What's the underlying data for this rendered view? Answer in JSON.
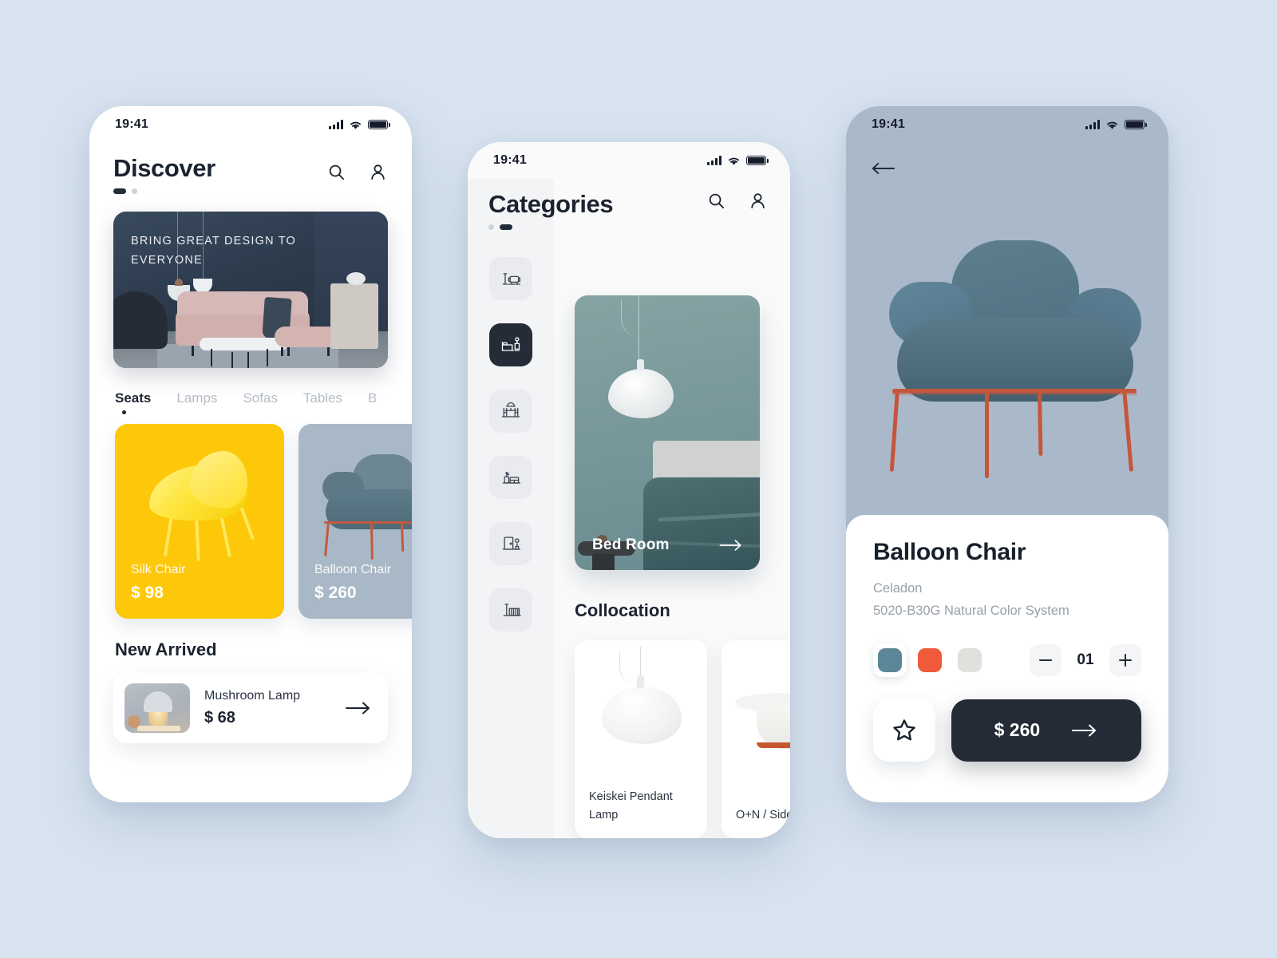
{
  "status_bar": {
    "time": "19:41",
    "signal_icon": "signal-bars-icon",
    "wifi_icon": "wifi-icon",
    "battery_icon": "battery-icon"
  },
  "discover": {
    "title": "Discover",
    "search_icon": "search-icon",
    "profile_icon": "profile-icon",
    "pagination": {
      "active_index": 0,
      "count": 2
    },
    "banner": {
      "headline": "BRING GREAT DESIGN TO EVERYONE",
      "wall_color": "#2e3d4f",
      "sofa_color": "#cfb0ad"
    },
    "tabs": [
      {
        "label": "Seats",
        "active": true
      },
      {
        "label": "Lamps",
        "active": false
      },
      {
        "label": "Sofas",
        "active": false
      },
      {
        "label": "Tables",
        "active": false
      },
      {
        "label": "B",
        "active": false
      }
    ],
    "products": [
      {
        "name": "Silk Chair",
        "price": "$ 98",
        "bg_color": "#fdc70a"
      },
      {
        "name": "Balloon Chair",
        "price": "$ 260",
        "bg_color": "#a9b8c6"
      }
    ],
    "new_arrived": {
      "section_title": "New Arrived",
      "item": {
        "name": "Mushroom Lamp",
        "price": "$ 68",
        "arrow_icon": "arrow-right-icon"
      }
    }
  },
  "categories": {
    "title": "Categories",
    "search_icon": "search-icon",
    "profile_icon": "profile-icon",
    "pagination": {
      "active_index": 1,
      "count": 2
    },
    "rail": [
      {
        "icon": "living-room-icon",
        "active": false
      },
      {
        "icon": "bed-room-icon",
        "active": true
      },
      {
        "icon": "dining-room-icon",
        "active": false
      },
      {
        "icon": "kitchen-icon",
        "active": false
      },
      {
        "icon": "entryway-icon",
        "active": false
      },
      {
        "icon": "nursery-icon",
        "active": false
      }
    ],
    "room_card": {
      "label": "Bed Room",
      "arrow_icon": "arrow-right-icon",
      "wall_color": "#7a999b"
    },
    "collocation": {
      "section_title": "Collocation",
      "items": [
        {
          "name": "Keiskei Pendant Lamp"
        },
        {
          "name": "O+N / Side t"
        }
      ]
    }
  },
  "detail": {
    "back_icon": "arrow-left-icon",
    "hero_bg_color": "#a6b6c8",
    "product": {
      "title": "Balloon Chair",
      "color_name": "Celadon",
      "color_code": "5020-B30G Natural Color System",
      "swatches": [
        {
          "name": "celadon-teal",
          "hex": "#5c8799",
          "selected": true
        },
        {
          "name": "coral-orange",
          "hex": "#ef5a3a",
          "selected": false
        },
        {
          "name": "light-gray",
          "hex": "#e0e0dd",
          "selected": false
        }
      ],
      "quantity": "01",
      "minus_label": "−",
      "plus_label": "+",
      "favorite_icon": "star-icon",
      "price": "$ 260",
      "buy_arrow_icon": "arrow-right-icon"
    }
  }
}
